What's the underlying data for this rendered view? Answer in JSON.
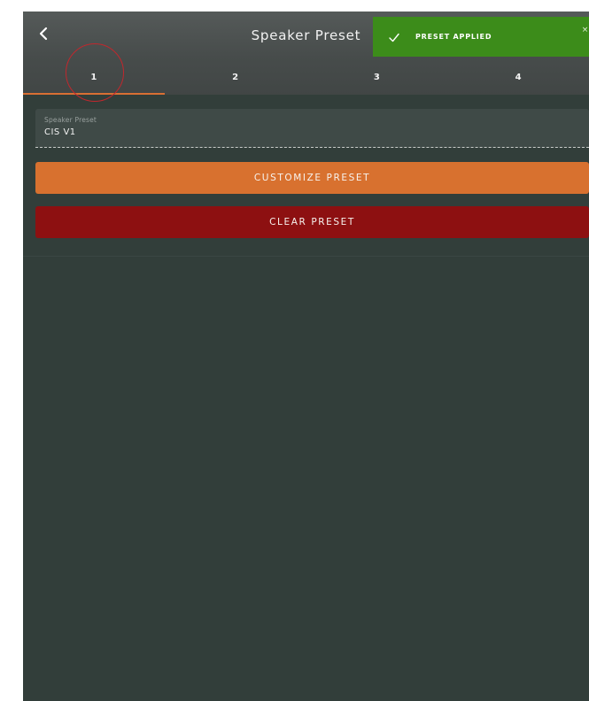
{
  "header": {
    "title": "Speaker Preset",
    "back_icon": "chevron-left-icon"
  },
  "tabs": [
    {
      "label": "1",
      "active": true
    },
    {
      "label": "2",
      "active": false
    },
    {
      "label": "3",
      "active": false
    },
    {
      "label": "4",
      "active": false
    }
  ],
  "preset_field": {
    "label": "Speaker Preset",
    "value": "CIS V1"
  },
  "buttons": {
    "customize_label": "CUSTOMIZE PRESET",
    "clear_label": "CLEAR PRESET"
  },
  "toast": {
    "message": "PRESET APPLIED",
    "icon": "check-icon",
    "close_label": "×"
  },
  "colors": {
    "background": "#323e3a",
    "accent_orange": "#d8712f",
    "danger_red": "#8d1011",
    "success_green": "#3c8c1a",
    "annotation_red": "#c1272d"
  }
}
